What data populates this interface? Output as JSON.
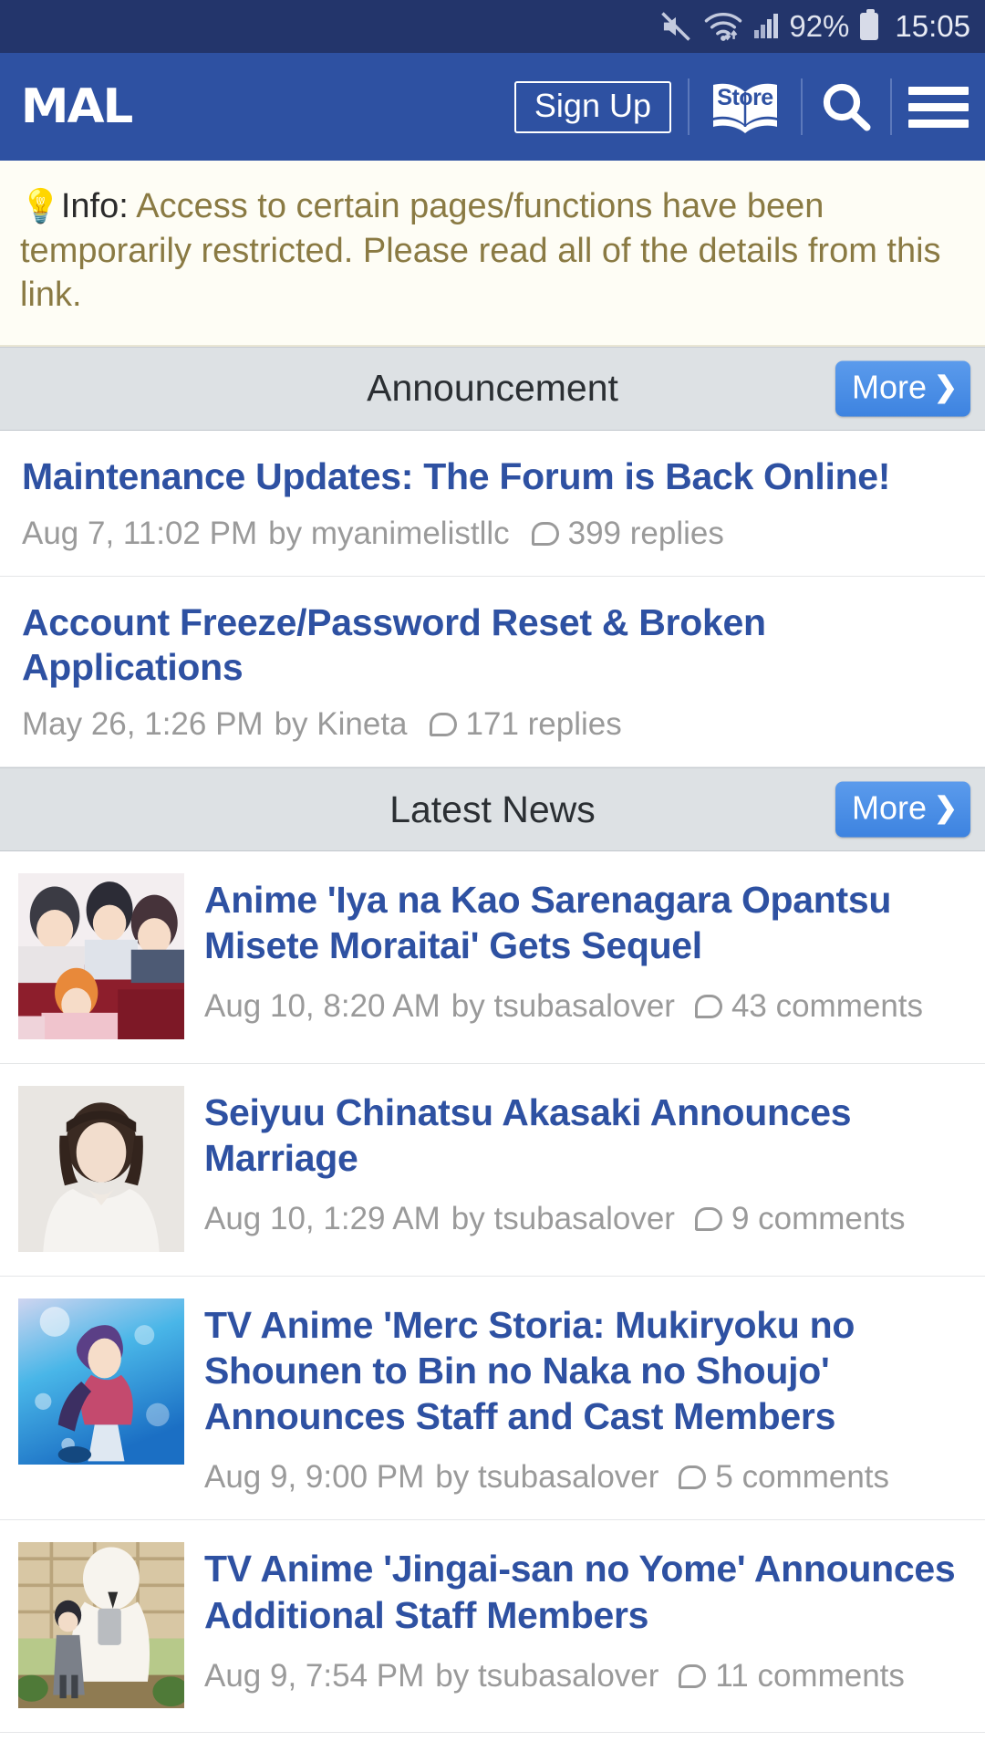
{
  "status_bar": {
    "mute_icon": "mute-icon",
    "wifi_icon": "wifi-icon",
    "signal_icon": "cellular-signal-icon",
    "battery_percent": "92%",
    "battery_icon": "battery-icon",
    "time": "15:05"
  },
  "header": {
    "logo": "MAL",
    "sign_up_label": "Sign Up",
    "store_label": "Store",
    "store_icon": "open-book-store-icon",
    "search_icon": "search-icon",
    "menu_icon": "hamburger-menu-icon"
  },
  "info_banner": {
    "bulb_icon": "lightbulb-icon",
    "label": "Info:",
    "message": "Access to certain pages/functions have been temporarily restricted. Please read all of the details from this link."
  },
  "announcement_section": {
    "title": "Announcement",
    "more_label": "More",
    "more_chevron": "❯",
    "items": [
      {
        "title": "Maintenance Updates: The Forum is Back Online!",
        "date": "Aug 7, 11:02 PM",
        "by": "by myanimelistllc",
        "replies": "399 replies"
      },
      {
        "title": "Account Freeze/Password Reset & Broken Applications",
        "date": "May 26, 1:26 PM",
        "by": "by Kineta",
        "replies": "171 replies"
      }
    ]
  },
  "news_section": {
    "title": "Latest News",
    "more_label": "More",
    "more_chevron": "❯",
    "items": [
      {
        "title": "Anime 'Iya na Kao Sarenagara Opantsu Misete Moraitai' Gets Sequel",
        "date": "Aug 10, 8:20 AM",
        "by": "by tsubasalover",
        "comments": "43 comments",
        "thumb": "anime-group-thumbnail"
      },
      {
        "title": "Seiyuu Chinatsu Akasaki Announces Marriage",
        "date": "Aug 10, 1:29 AM",
        "by": "by tsubasalover",
        "comments": "9 comments",
        "thumb": "seiyuu-portrait-thumbnail"
      },
      {
        "title": "TV Anime 'Merc Storia: Mukiryoku no Shounen to Bin no Naka no Shoujo' Announces Staff and Cast Members",
        "date": "Aug 9, 9:00 PM",
        "by": "by tsubasalover",
        "comments": "5 comments",
        "thumb": "merc-storia-thumbnail"
      },
      {
        "title": "TV Anime 'Jingai-san no Yome' Announces Additional Staff Members",
        "date": "Aug 9, 7:54 PM",
        "by": "by tsubasalover",
        "comments": "11 comments",
        "thumb": "jingai-san-thumbnail"
      }
    ]
  },
  "colors": {
    "status_bar_bg": "#23356b",
    "header_bg": "#2e51a2",
    "link_blue": "#2e51a2",
    "section_bg": "#dde1e4",
    "more_blue": "#3d83e0",
    "info_bg": "#fefdf5",
    "info_text": "#8a7a43",
    "meta_gray": "#9a9a9a"
  }
}
